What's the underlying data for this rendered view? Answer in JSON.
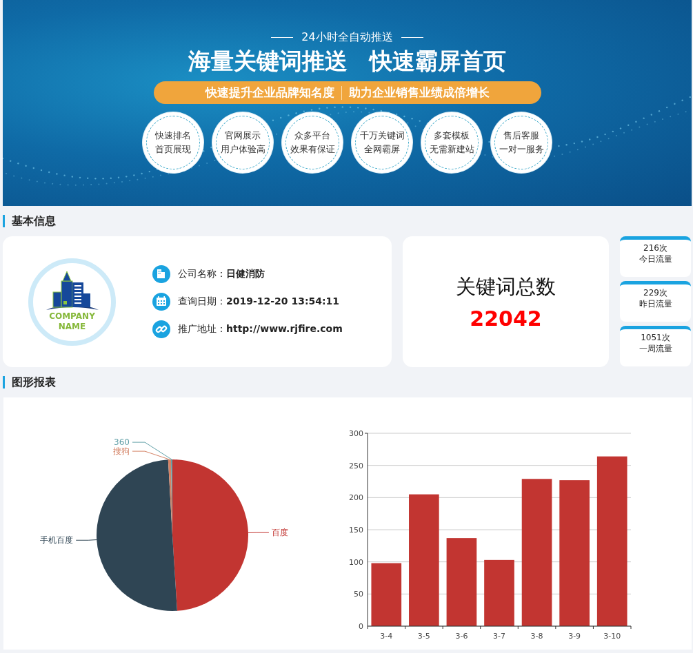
{
  "banner": {
    "subtitle": "24小时全自动推送",
    "headline": [
      "海量关键词推送",
      "快速霸屏首页"
    ],
    "slogans": [
      "快速提升企业品牌知名度",
      "助力企业销售业绩成倍增长"
    ],
    "features": [
      [
        "快速排名",
        "首页展现"
      ],
      [
        "官网展示",
        "用户体验高"
      ],
      [
        "众多平台",
        "效果有保证"
      ],
      [
        "千万关键词",
        "全网霸屏"
      ],
      [
        "多套模板",
        "无需新建站"
      ],
      [
        "售后客服",
        "一对一服务"
      ]
    ]
  },
  "basic_info": {
    "title": "基本信息",
    "logo": [
      "COMPANY",
      "NAME"
    ],
    "fields": [
      {
        "kind": "building",
        "label": "公司名称：",
        "value": "日健消防"
      },
      {
        "kind": "calendar",
        "label": "查询日期：",
        "value": "2019-12-20 13:54:11"
      },
      {
        "kind": "link",
        "label": "推广地址：",
        "value": "http://www.rjfire.com"
      }
    ],
    "keyword_total": {
      "label": "关键词总数",
      "value": "22042"
    },
    "traffic": [
      {
        "count": "216次",
        "label": "今日流量"
      },
      {
        "count": "229次",
        "label": "昨日流量"
      },
      {
        "count": "1051次",
        "label": "一周流量"
      }
    ]
  },
  "reports": {
    "title": "图形报表",
    "pie": {
      "chart_data": {
        "type": "pie",
        "categories": [
          "百度",
          "手机百度",
          "搜狗",
          "360"
        ],
        "values": [
          49.0,
          50.1,
          0.6,
          0.3
        ],
        "colors": [
          "#c23531",
          "#2f4554",
          "#d48265",
          "#61a0a8"
        ]
      }
    },
    "bar": {
      "chart_data": {
        "type": "bar",
        "categories": [
          "3-4",
          "3-5",
          "3-6",
          "3-7",
          "3-8",
          "3-9",
          "3-10"
        ],
        "series": [
          {
            "color": "#c23531",
            "values": [
              98,
              205,
              137,
              103,
              229,
              227,
              264
            ]
          }
        ],
        "grid": true,
        "ylim": [
          0,
          300
        ],
        "yticks": [
          0,
          50,
          100,
          150,
          200,
          250,
          300
        ]
      }
    }
  }
}
